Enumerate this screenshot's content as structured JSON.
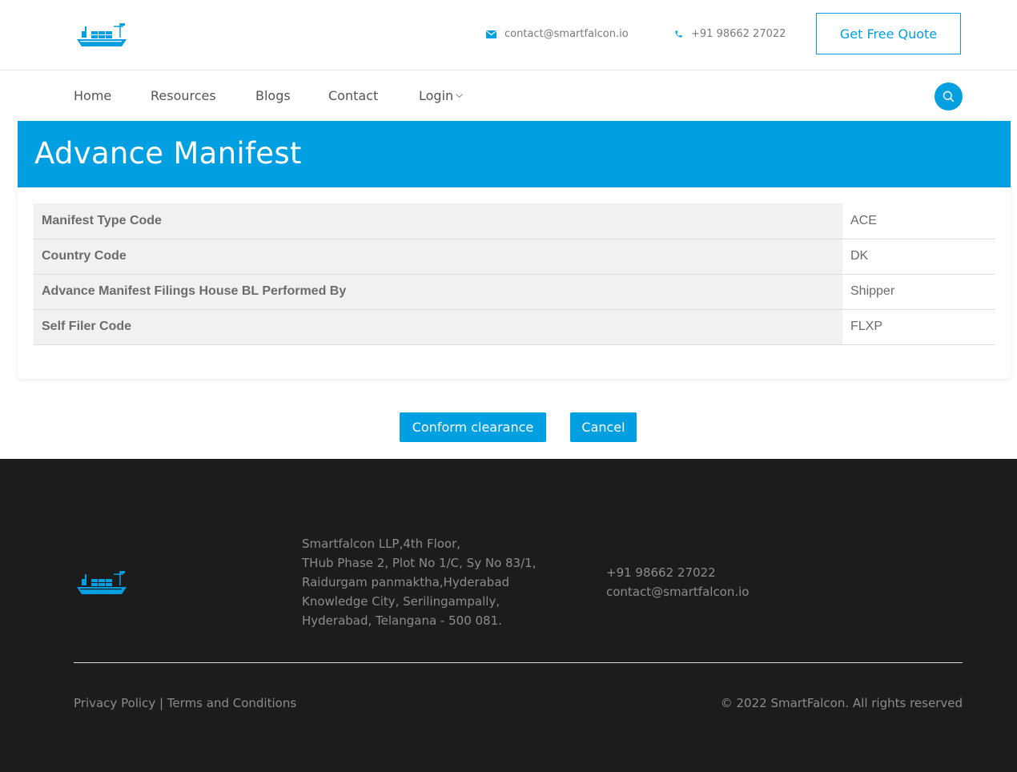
{
  "header": {
    "email": "contact@smartfalcon.io",
    "phone": "+91 98662 27022",
    "quote_button": "Get Free Quote"
  },
  "nav": {
    "items": [
      {
        "label": "Home"
      },
      {
        "label": "Resources"
      },
      {
        "label": "Blogs"
      },
      {
        "label": "Contact"
      },
      {
        "label": "Login"
      }
    ]
  },
  "page": {
    "title": "Advance Manifest",
    "rows": [
      {
        "key": "Manifest Type Code",
        "value": "ACE"
      },
      {
        "key": "Country Code",
        "value": "DK"
      },
      {
        "key": "Advance Manifest Filings House BL Performed By",
        "value": "Shipper"
      },
      {
        "key": "Self Filer Code",
        "value": "FLXP"
      }
    ],
    "confirm_button": "Conform clearance",
    "cancel_button": "Cancel"
  },
  "footer": {
    "address": [
      "Smartfalcon LLP,4th Floor,",
      "THub Phase 2, Plot No 1/C, Sy No 83/1,",
      "Raidurgam panmaktha,Hyderabad",
      "Knowledge City, Serilingampally,",
      "Hyderabad, Telangana - 500 081."
    ],
    "phone": "+91 98662 27022",
    "email": "contact@smartfalcon.io",
    "privacy": "Privacy Policy",
    "separator": " | ",
    "terms": "Terms and Conditions",
    "copyright": "© 2022 SmartFalcon. All rights reserved"
  },
  "icons": {
    "logo": "ship-logo-icon",
    "email": "envelope-icon",
    "phone": "phone-icon",
    "search": "search-icon",
    "dropdown": "chevron-down-icon"
  },
  "colors": {
    "accent": "#009fe1",
    "footer_bg": "#1c1c1d",
    "row_key_bg": "#f1f1f1"
  }
}
